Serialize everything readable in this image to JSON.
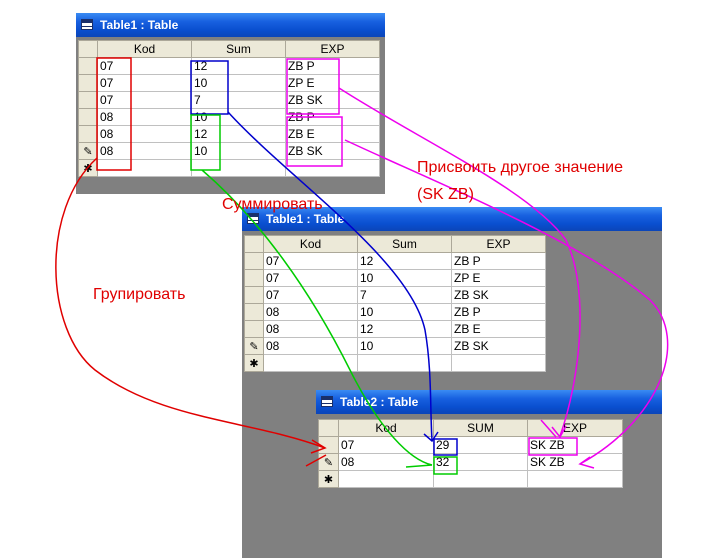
{
  "table1": {
    "title": "Table1 : Table",
    "columns": [
      "Kod",
      "Sum",
      "EXP"
    ],
    "rows": [
      [
        "07",
        "12",
        "ZB P"
      ],
      [
        "07",
        "10",
        "ZP E"
      ],
      [
        "07",
        "7",
        "ZB SK"
      ],
      [
        "08",
        "10",
        "ZB P"
      ],
      [
        "08",
        "12",
        "ZB E"
      ],
      [
        "08",
        "10",
        "ZB SK"
      ]
    ]
  },
  "table1_copy": {
    "title": "Table1 : Table",
    "columns": [
      "Kod",
      "Sum",
      "EXP"
    ],
    "rows": [
      [
        "07",
        "12",
        "ZB P"
      ],
      [
        "07",
        "10",
        "ZP E"
      ],
      [
        "07",
        "7",
        "ZB SK"
      ],
      [
        "08",
        "10",
        "ZB P"
      ],
      [
        "08",
        "12",
        "ZB E"
      ],
      [
        "08",
        "10",
        "ZB SK"
      ]
    ]
  },
  "table2": {
    "title": "Table2 : Table",
    "columns": [
      "Kod",
      "SUM",
      "EXP"
    ],
    "rows": [
      [
        "07",
        "29",
        "SK ZB"
      ],
      [
        "08",
        "32",
        "SK ZB"
      ]
    ]
  },
  "row_markers": {
    "edit": "✎",
    "new": "✱"
  },
  "annotations": {
    "group": "Групировать",
    "sum": "Суммировать",
    "assign_line1": "Присвоить другое значение",
    "assign_line2": "(SK ZB)"
  },
  "colors": {
    "group": "#e00000",
    "sum": "#00cc00",
    "sum_box": "#0000cc",
    "assign": "#ee00ee"
  }
}
